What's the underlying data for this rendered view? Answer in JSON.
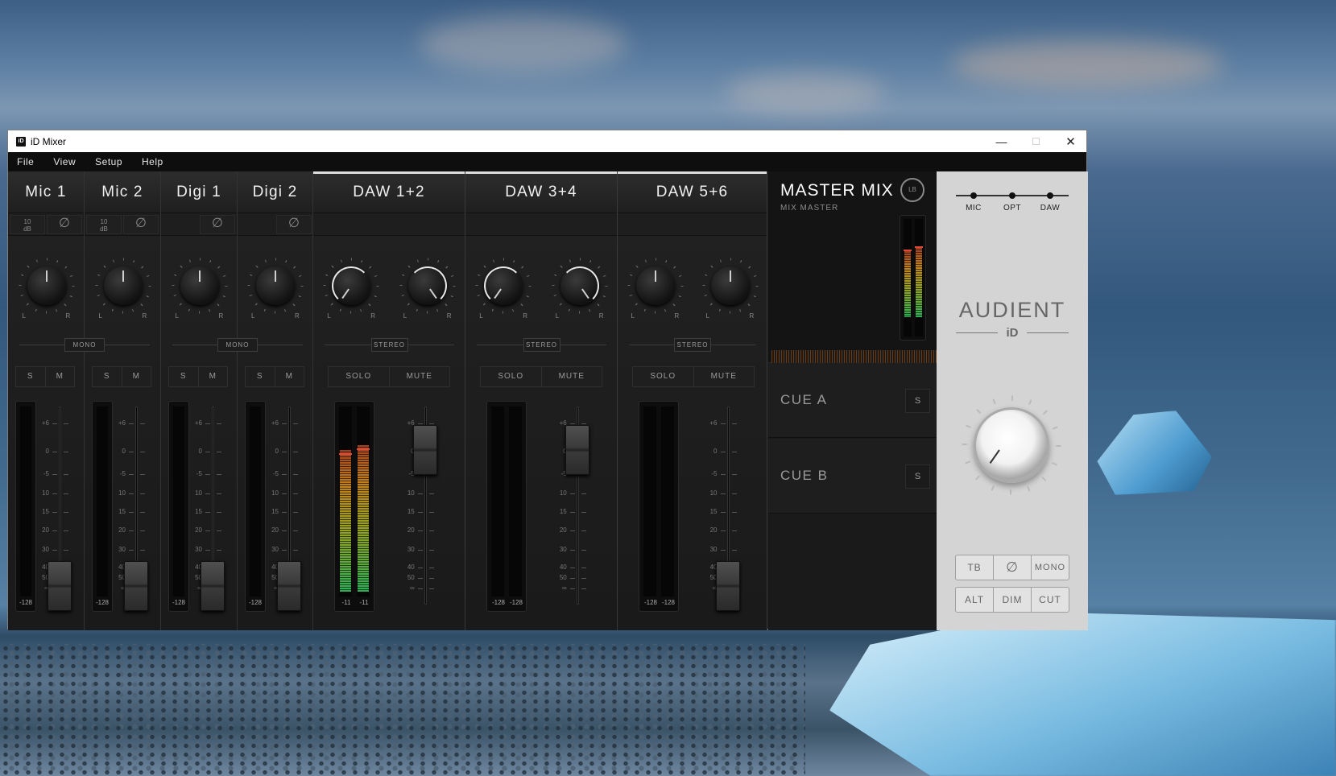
{
  "window": {
    "title": "iD Mixer",
    "app_icon": "iD",
    "minimize": "—",
    "maximize": "☐",
    "close": "✕"
  },
  "menu": [
    "File",
    "View",
    "Setup",
    "Help"
  ],
  "channels": [
    {
      "name": "Mic 1",
      "pad": "10\ndB",
      "mode": "MONO",
      "buttons": [
        "S",
        "M"
      ],
      "meter": "-128"
    },
    {
      "name": "Mic 2",
      "pad": "10\ndB",
      "mode": "",
      "buttons": [
        "S",
        "M"
      ],
      "meter": "-128"
    },
    {
      "name": "Digi 1",
      "pad": "",
      "mode": "MONO",
      "buttons": [
        "S",
        "M"
      ],
      "meter": "-128"
    },
    {
      "name": "Digi 2",
      "pad": "",
      "mode": "",
      "buttons": [
        "S",
        "M"
      ],
      "meter": "-128"
    },
    {
      "name": "DAW 1+2",
      "mode": "STEREO",
      "buttons": [
        "SOLO",
        "MUTE"
      ],
      "meter_l": "-11",
      "meter_r": "-11"
    },
    {
      "name": "DAW 3+4",
      "mode": "STEREO",
      "buttons": [
        "SOLO",
        "MUTE"
      ],
      "meter_l": "-128",
      "meter_r": "-128"
    },
    {
      "name": "DAW 5+6",
      "mode": "STEREO",
      "buttons": [
        "SOLO",
        "MUTE"
      ],
      "meter_l": "-128",
      "meter_r": "-128"
    }
  ],
  "pan_labels": {
    "l": "L",
    "r": "R"
  },
  "fader_scale": [
    "+6",
    "0",
    "-5",
    "10",
    "15",
    "20",
    "30",
    "40",
    "50",
    "∞"
  ],
  "phase_symbol": "∅",
  "master": {
    "title": "MASTER MIX",
    "subtitle": "MIX MASTER",
    "lb_icon": "LB"
  },
  "cues": [
    {
      "label": "CUE A",
      "button": "S"
    },
    {
      "label": "CUE B",
      "button": "S"
    }
  ],
  "source_switch": [
    "MIC",
    "OPT",
    "DAW"
  ],
  "brand": {
    "name": "AUDIENT",
    "sub": "iD"
  },
  "monitor_row1": [
    "TB",
    "∅",
    "MONO"
  ],
  "monitor_row2": [
    "ALT",
    "DIM",
    "CUT"
  ]
}
